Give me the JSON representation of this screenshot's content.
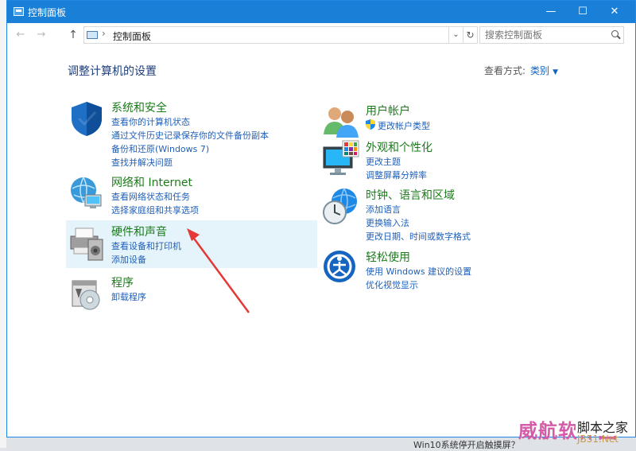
{
  "window": {
    "title": "控制面板",
    "controls": {
      "minimize": "—",
      "maximize": "☐",
      "close": "✕"
    }
  },
  "address_bar": {
    "back": "←",
    "forward": "→",
    "up": "↑",
    "separator": "›",
    "breadcrumb": "控制面板",
    "dropdown": "⌄",
    "refresh": "↻",
    "search_placeholder": "搜索控制面板"
  },
  "content": {
    "heading": "调整计算机的设置",
    "view_by_label": "查看方式:",
    "view_by_value": "类别",
    "view_by_caret": "▼"
  },
  "categories_left": [
    {
      "icon": "shield-icon",
      "title": "系统和安全",
      "links": [
        "查看你的计算机状态",
        "通过文件历史记录保存你的文件备份副本",
        "备份和还原(Windows 7)",
        "查找并解决问题"
      ]
    },
    {
      "icon": "network-globe-icon",
      "title": "网络和 Internet",
      "links": [
        "查看网络状态和任务",
        "选择家庭组和共享选项"
      ]
    },
    {
      "icon": "printer-speaker-icon",
      "title": "硬件和声音",
      "links": [
        "查看设备和打印机",
        "添加设备"
      ]
    },
    {
      "icon": "programs-disc-icon",
      "title": "程序",
      "links": [
        "卸载程序"
      ]
    }
  ],
  "categories_right": [
    {
      "icon": "users-icon",
      "title": "用户帐户",
      "links": [
        "更改帐户类型"
      ]
    },
    {
      "icon": "monitor-palette-icon",
      "title": "外观和个性化",
      "links": [
        "更改主题",
        "调整屏幕分辨率"
      ]
    },
    {
      "icon": "clock-globe-icon",
      "title": "时钟、语言和区域",
      "links": [
        "添加语言",
        "更换输入法",
        "更改日期、时间或数字格式"
      ]
    },
    {
      "icon": "ease-of-access-icon",
      "title": "轻松使用",
      "links": [
        "使用 Windows 建议的设置",
        "优化视觉显示"
      ]
    }
  ],
  "overlay": {
    "watermark_red": "威航软件园",
    "watermark_black": "脚本之家",
    "watermark_site": "JB51.Net",
    "bottom_text": "Win10系统停开启触摸屏？"
  },
  "colors": {
    "titlebar": "#1a7fd6",
    "category_title": "#1b7b1b",
    "link": "#1f5fb8",
    "highlight": "#e5f3fb",
    "arrow": "#e53935"
  }
}
